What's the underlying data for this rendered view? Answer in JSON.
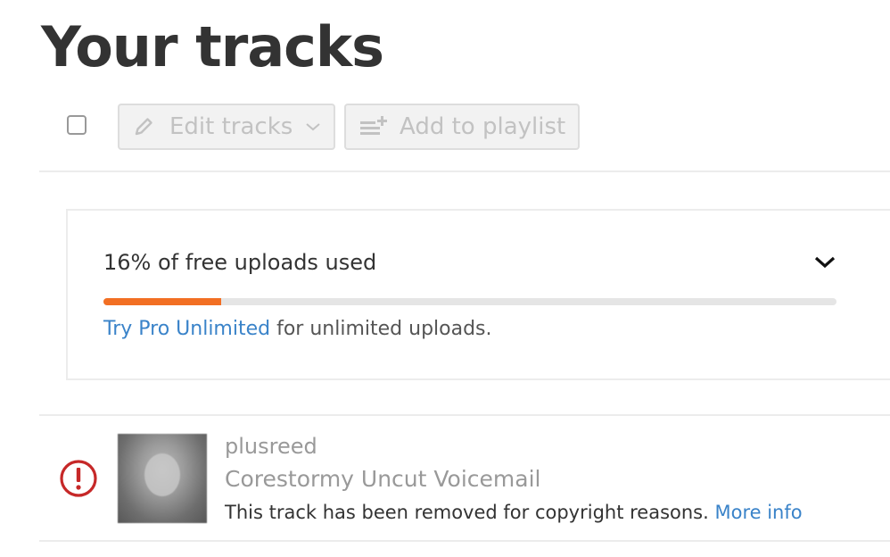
{
  "page": {
    "title": "Your tracks"
  },
  "toolbar": {
    "select_all_checked": false,
    "edit_label": "Edit tracks",
    "edit_icon": "pencil-icon",
    "edit_dropdown_icon": "chevron-down-icon",
    "add_label": "Add to playlist",
    "add_icon": "add-to-playlist-icon",
    "disabled": true
  },
  "quota": {
    "status": "16% of free uploads used",
    "used_fraction": 0.16,
    "bar_color": "#f26f23",
    "link_text": "Try Pro Unlimited",
    "note_suffix": " for unlimited uploads.",
    "toggle_icon": "chevron-down-icon"
  },
  "tracks": [
    {
      "artist": "plusreed",
      "title": "Corestormy Uncut Voicemail",
      "status_icon": "alert-icon",
      "status_color": "#c62828",
      "message": "This track has been removed for copyright reasons. ",
      "more_info": "More info"
    }
  ]
}
